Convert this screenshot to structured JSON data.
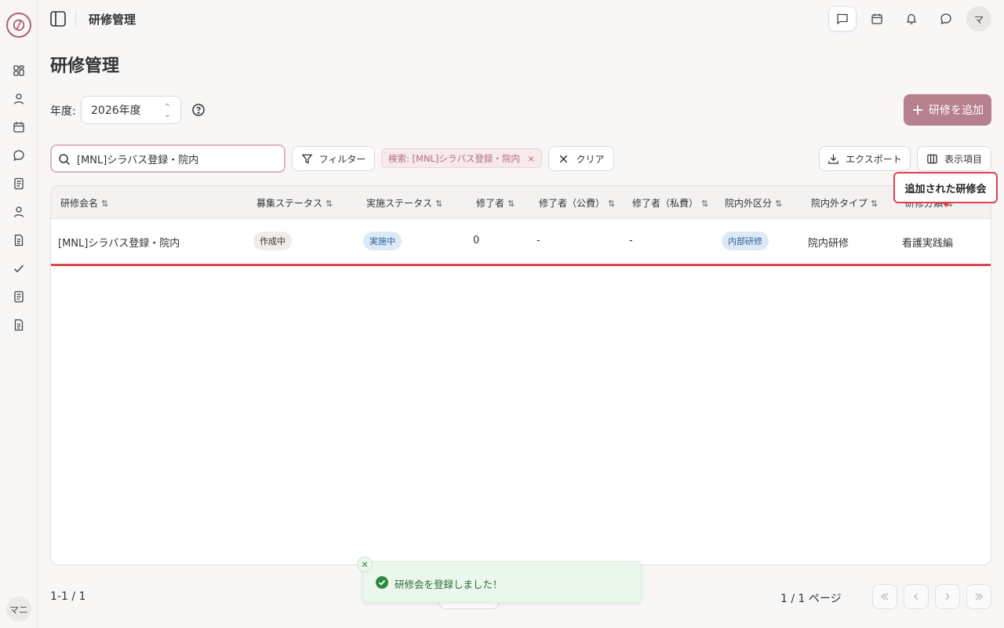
{
  "header": {
    "title": "研修管理",
    "avatar_text": "マ"
  },
  "sidebar": {
    "user_text": "マニ",
    "icons": [
      "dashboard-icon",
      "user-icon",
      "calendar-icon",
      "chat-icon",
      "list-icon",
      "user-icon",
      "document-icon",
      "check-icon",
      "list-icon",
      "document-icon"
    ]
  },
  "page": {
    "title": "研修管理",
    "year_label": "年度:",
    "year_value": "2026年度",
    "add_button": "研修を追加"
  },
  "toolbar": {
    "search_value": "[MNL]シラバス登録・院内",
    "filter_label": "フィルター",
    "search_chip": "検索: [MNL]シラバス登録・院内",
    "clear_label": "クリア",
    "export_label": "エクスポート",
    "columns_label": "表示項目"
  },
  "table": {
    "columns": [
      "研修会名",
      "募集ステータス",
      "実施ステータス",
      "修了者",
      "修了者（公費）",
      "修了者（私費）",
      "院内外区分",
      "院内外タイプ",
      "研修分類"
    ],
    "rows": [
      {
        "name": "[MNL]シラバス登録・院内",
        "recruit_status": "作成中",
        "exec_status": "実施中",
        "completed": "0",
        "completed_public": "-",
        "completed_private": "-",
        "inout_category": "内部研修",
        "inout_type": "院内研修",
        "category": "看護実践編"
      }
    ]
  },
  "callout": {
    "text": "追加された研修会"
  },
  "footer": {
    "range": "1-1 / 1",
    "page": "1 / 1 ページ"
  },
  "toast": {
    "message": "研修会を登録しました！"
  },
  "colors": {
    "accent": "#b6808c",
    "highlight": "#d9434f",
    "success": "#2f8a3e"
  }
}
